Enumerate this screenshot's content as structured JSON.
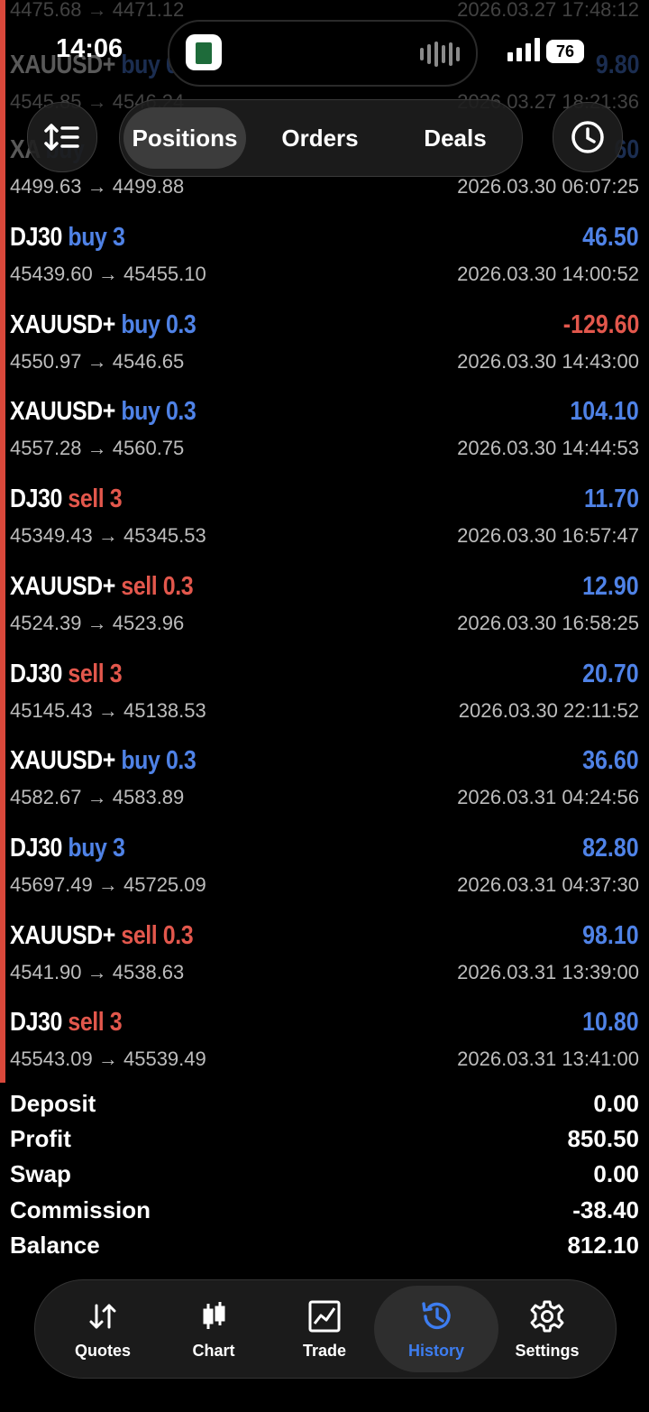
{
  "status": {
    "time": "14:06",
    "battery": "76"
  },
  "tabs": [
    "Positions",
    "Orders",
    "Deals"
  ],
  "ghost_rows": [
    {
      "prices": "4475.68 → 4471.12",
      "time": "2026.03.27 17:48:12"
    },
    {
      "sym": "XAUUSD+",
      "side": "buy",
      "vol": "0.3",
      "profit": "9.80",
      "prices": "4545.85 → 4546.24",
      "time": "2026.03.27 18:21:36"
    },
    {
      "sym": "XA",
      "side": "buy",
      "profit": "60",
      "prices": "4499.63 → 4499.88",
      "time": "2026.03.30 06:07:25"
    }
  ],
  "deals": [
    {
      "sym": "DJ30",
      "side": "buy",
      "vol": "3",
      "profit": "46.50",
      "prices": "45439.60 → 45455.10",
      "time": "2026.03.30 14:00:52"
    },
    {
      "sym": "XAUUSD+",
      "side": "buy",
      "vol": "0.3",
      "profit": "-129.60",
      "prices": "4550.97 → 4546.65",
      "time": "2026.03.30 14:43:00"
    },
    {
      "sym": "XAUUSD+",
      "side": "buy",
      "vol": "0.3",
      "profit": "104.10",
      "prices": "4557.28 → 4560.75",
      "time": "2026.03.30 14:44:53"
    },
    {
      "sym": "DJ30",
      "side": "sell",
      "vol": "3",
      "profit": "11.70",
      "prices": "45349.43 → 45345.53",
      "time": "2026.03.30 16:57:47"
    },
    {
      "sym": "XAUUSD+",
      "side": "sell",
      "vol": "0.3",
      "profit": "12.90",
      "prices": "4524.39 → 4523.96",
      "time": "2026.03.30 16:58:25"
    },
    {
      "sym": "DJ30",
      "side": "sell",
      "vol": "3",
      "profit": "20.70",
      "prices": "45145.43 → 45138.53",
      "time": "2026.03.30 22:11:52"
    },
    {
      "sym": "XAUUSD+",
      "side": "buy",
      "vol": "0.3",
      "profit": "36.60",
      "prices": "4582.67 → 4583.89",
      "time": "2026.03.31 04:24:56"
    },
    {
      "sym": "DJ30",
      "side": "buy",
      "vol": "3",
      "profit": "82.80",
      "prices": "45697.49 → 45725.09",
      "time": "2026.03.31 04:37:30"
    },
    {
      "sym": "XAUUSD+",
      "side": "sell",
      "vol": "0.3",
      "profit": "98.10",
      "prices": "4541.90 → 4538.63",
      "time": "2026.03.31 13:39:00"
    },
    {
      "sym": "DJ30",
      "side": "sell",
      "vol": "3",
      "profit": "10.80",
      "prices": "45543.09 → 45539.49",
      "time": "2026.03.31 13:41:00"
    }
  ],
  "summary": [
    {
      "label": "Deposit",
      "value": "0.00"
    },
    {
      "label": "Profit",
      "value": "850.50"
    },
    {
      "label": "Swap",
      "value": "0.00"
    },
    {
      "label": "Commission",
      "value": "-38.40"
    },
    {
      "label": "Balance",
      "value": "812.10"
    }
  ],
  "nav": [
    {
      "label": "Quotes",
      "icon": "quotes-icon"
    },
    {
      "label": "Chart",
      "icon": "chart-icon"
    },
    {
      "label": "Trade",
      "icon": "trade-icon"
    },
    {
      "label": "History",
      "icon": "history-icon",
      "active": true
    },
    {
      "label": "Settings",
      "icon": "settings-icon"
    }
  ],
  "colors": {
    "buy": "#4f82e6",
    "sell": "#e2574c",
    "active_nav": "#3d7df0"
  }
}
